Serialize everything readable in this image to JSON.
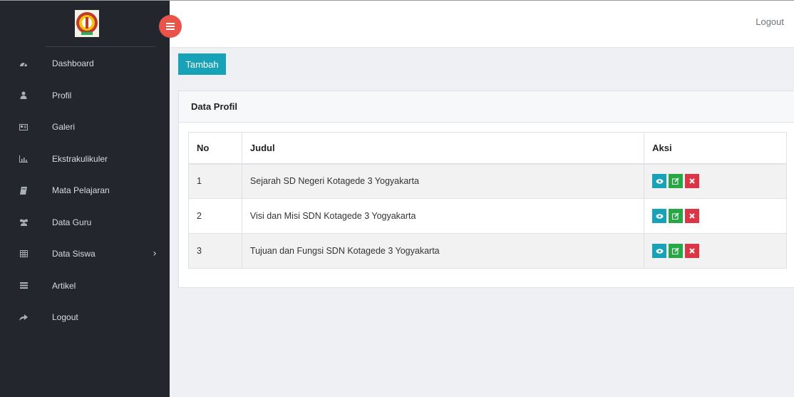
{
  "sidebar": {
    "items": [
      {
        "label": "Dashboard",
        "icon": "dashboard-icon"
      },
      {
        "label": "Profil",
        "icon": "user-icon"
      },
      {
        "label": "Galeri",
        "icon": "gallery-icon"
      },
      {
        "label": "Ekstrakulikuler",
        "icon": "bar-chart-icon"
      },
      {
        "label": "Mata Pelajaran",
        "icon": "book-icon"
      },
      {
        "label": "Data Guru",
        "icon": "users-icon"
      },
      {
        "label": "Data Siswa",
        "icon": "table-icon",
        "has_submenu": true,
        "chevron": "›"
      },
      {
        "label": "Artikel",
        "icon": "list-icon"
      },
      {
        "label": "Logout",
        "icon": "share-icon"
      }
    ]
  },
  "topbar": {
    "logout_label": "Logout"
  },
  "toolbar": {
    "add_label": "Tambah"
  },
  "card": {
    "title": "Data Profil",
    "table": {
      "headers": {
        "no": "No",
        "judul": "Judul",
        "aksi": "Aksi"
      },
      "rows": [
        {
          "no": "1",
          "judul": "Sejarah SD Negeri Kotagede 3 Yogyakarta"
        },
        {
          "no": "2",
          "judul": "Visi dan Misi SDN Kotagede 3 Yogyakarta"
        },
        {
          "no": "3",
          "judul": "Tujuan dan Fungsi SDN Kotagede 3 Yogyakarta"
        }
      ]
    }
  },
  "colors": {
    "sidebar_bg": "#23272d",
    "accent_teal": "#17a2b8",
    "accent_green": "#28a745",
    "accent_red": "#dc3545",
    "toggle_red": "#e8534a"
  }
}
